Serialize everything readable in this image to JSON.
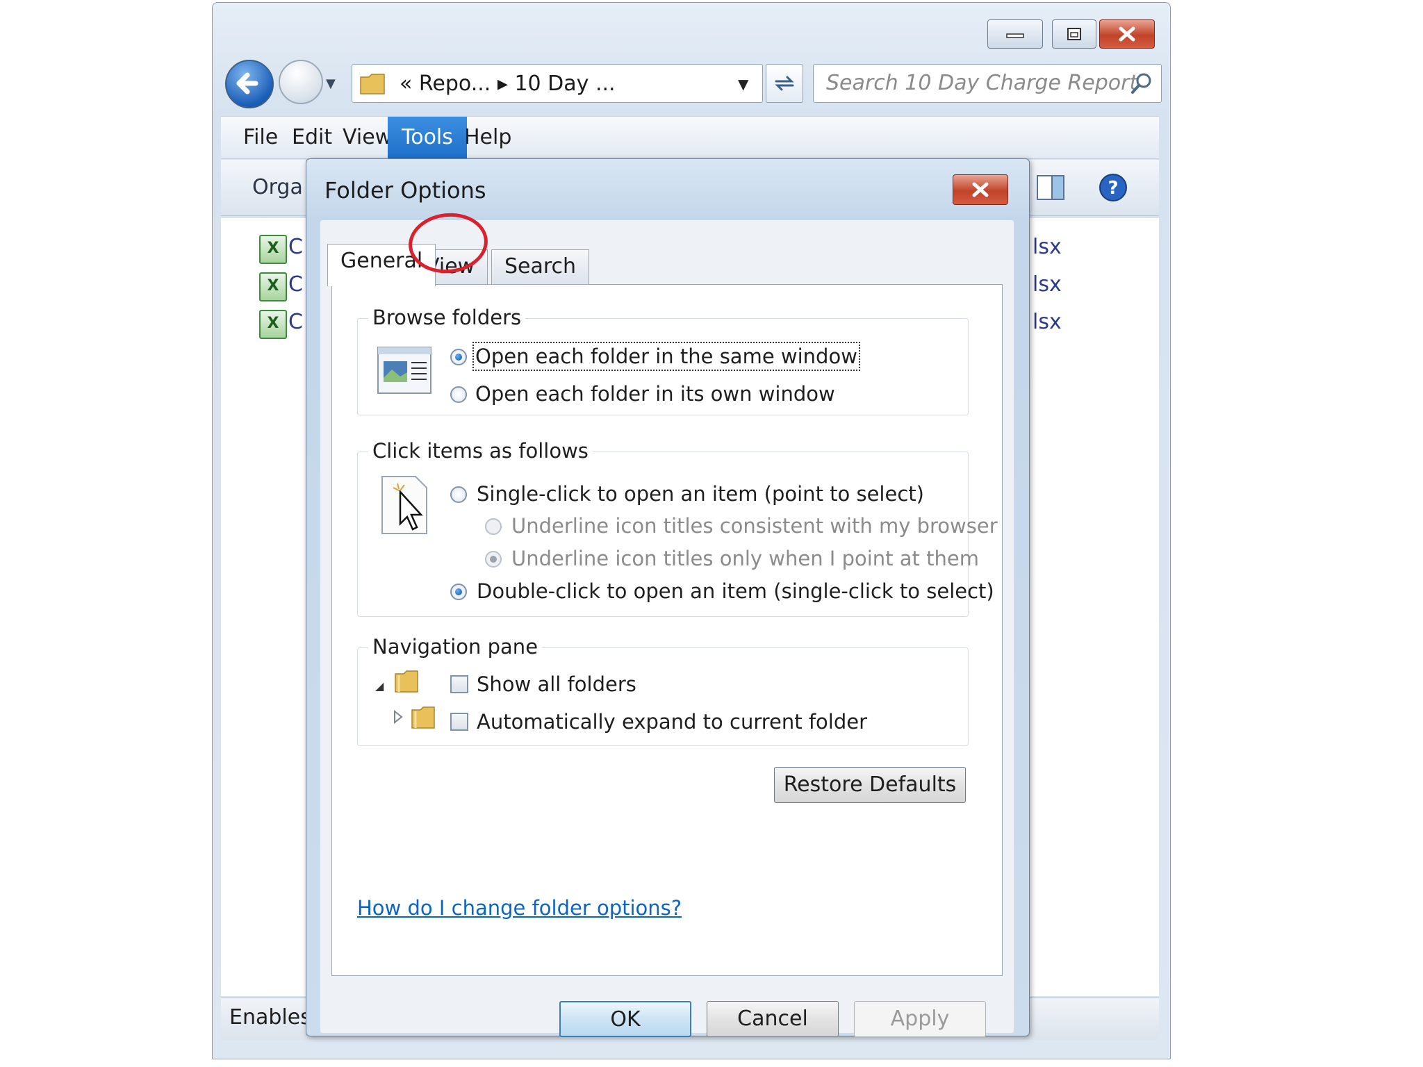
{
  "explorer": {
    "address_text": "« Repo... ▸ 10 Day ...",
    "search_placeholder": "Search 10 Day Charge Report",
    "menu": [
      "File",
      "Edit",
      "View",
      "Tools",
      "Help"
    ],
    "active_menu": "Tools",
    "toolbar_organize": "Orga",
    "files": [
      {
        "label": "C",
        "ext": "lsx"
      },
      {
        "label": "C",
        "ext": "lsx"
      },
      {
        "label": "C",
        "ext": "lsx"
      }
    ],
    "status_text": "Enables you to change settings."
  },
  "dialog": {
    "title": "Folder Options",
    "tabs": [
      "General",
      "View",
      "Search"
    ],
    "selected_tab": "General",
    "highlighted_tab": "View",
    "highlight_color": "#d8222d",
    "browse_folders": {
      "legend": "Browse folders",
      "options": [
        {
          "label": "Open each folder in the same window",
          "checked": true
        },
        {
          "label": "Open each folder in its own window",
          "checked": false
        }
      ]
    },
    "click_items": {
      "legend": "Click items as follows",
      "options": [
        {
          "label": "Single-click to open an item (point to select)",
          "checked": false,
          "enabled": true
        },
        {
          "label": "Underline icon titles consistent with my browser",
          "checked": false,
          "enabled": false
        },
        {
          "label": "Underline icon titles only when I point at them",
          "checked": true,
          "enabled": false
        },
        {
          "label": "Double-click to open an item (single-click to select)",
          "checked": true,
          "enabled": true
        }
      ]
    },
    "navigation_pane": {
      "legend": "Navigation pane",
      "options": [
        {
          "label": "Show all folders",
          "checked": false
        },
        {
          "label": "Automatically expand to current folder",
          "checked": false
        }
      ]
    },
    "restore_defaults": "Restore Defaults",
    "help_link": "How do I change folder options?",
    "buttons": {
      "ok": "OK",
      "cancel": "Cancel",
      "apply": "Apply"
    }
  }
}
